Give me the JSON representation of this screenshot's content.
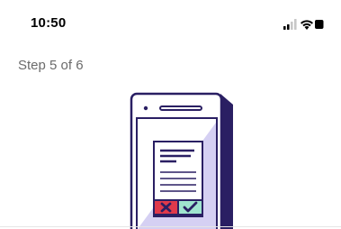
{
  "status_bar": {
    "time": "10:50",
    "icons": [
      "cellular-signal-icon",
      "wifi-icon",
      "battery-icon"
    ]
  },
  "onboarding": {
    "step_label": "Step 5 of 6",
    "illustration": "phone-document-review-illustration"
  },
  "colors": {
    "phone_outline": "#2a1f63",
    "phone_fill": "#c9c4ee",
    "screen_fill": "#ffffff",
    "reject_red": "#e0394b",
    "approve_green": "#9fe4cf",
    "divider": "#e6e6e6"
  }
}
